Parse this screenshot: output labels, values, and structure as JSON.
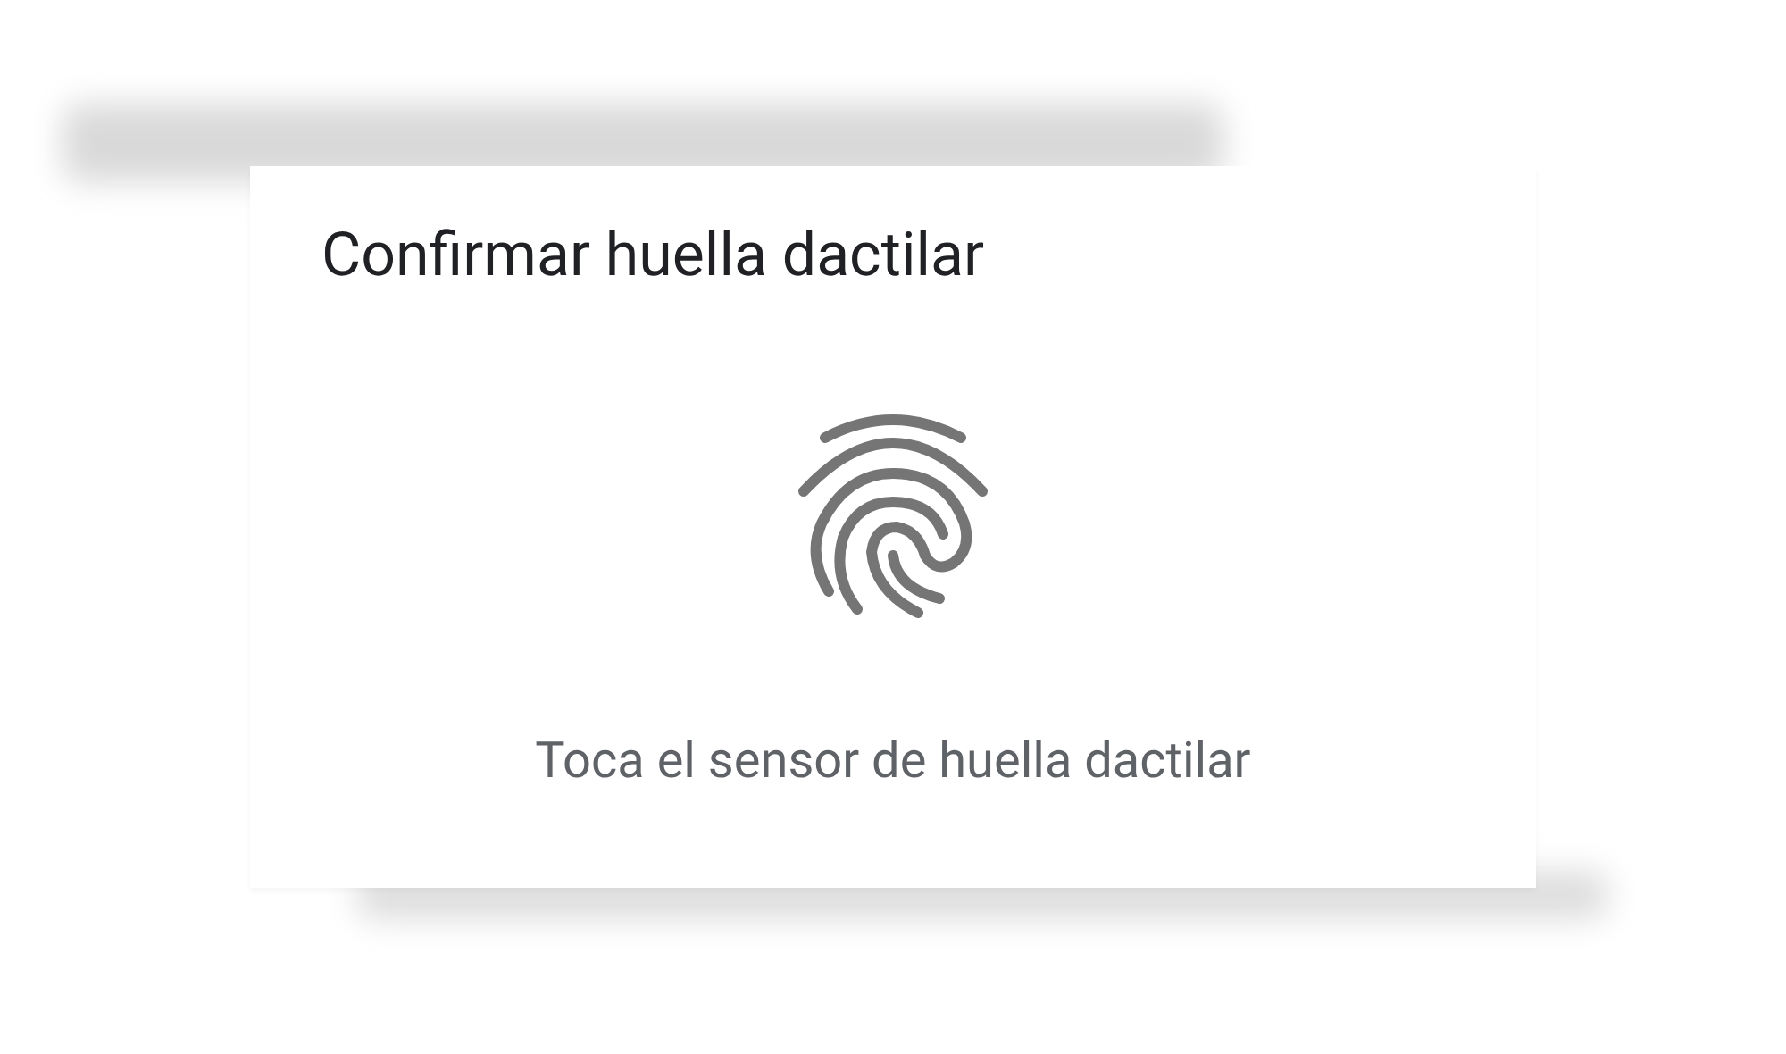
{
  "dialog": {
    "title": "Confirmar huella dactilar",
    "instruction": "Toca el sensor de huella dactilar"
  }
}
